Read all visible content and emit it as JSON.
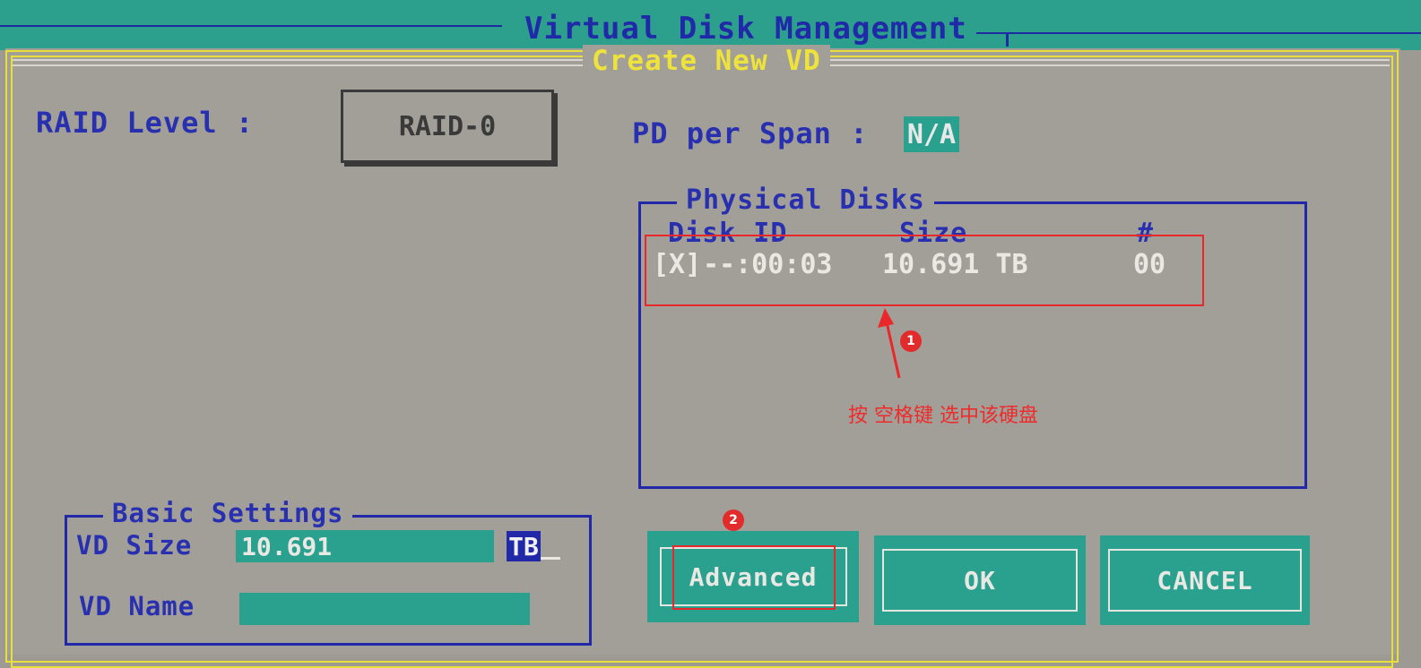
{
  "header": {
    "title": "Virtual Disk Management"
  },
  "dialog": {
    "title": "Create New VD",
    "raid_level_label": "RAID Level  :",
    "raid_level_value": "RAID-0",
    "pd_per_span_label": "PD per Span :",
    "pd_per_span_value": "N/A"
  },
  "physical_disks": {
    "title": "Physical Disks",
    "columns": [
      "Disk ID",
      "Size",
      "#"
    ],
    "rows": [
      {
        "selected": "[X]",
        "disk_id": "--:00:03",
        "size": "10.691 TB",
        "number": "00"
      }
    ]
  },
  "basic_settings": {
    "title": "Basic Settings",
    "vd_size_label": "VD Size",
    "vd_size_value": "10.691",
    "vd_size_unit": "TB",
    "vd_name_label": "VD Name",
    "vd_name_value": ""
  },
  "buttons": {
    "advanced": "Advanced",
    "ok": "OK",
    "cancel": "CANCEL"
  },
  "annotations": {
    "badge_1": "1",
    "badge_2": "2",
    "hint": "按 空格键 选中该硬盘",
    "color": "#e8282a"
  },
  "colors": {
    "teal": "#2aa08f",
    "blue_text": "#2830b0",
    "yellow": "#e8df3a"
  }
}
